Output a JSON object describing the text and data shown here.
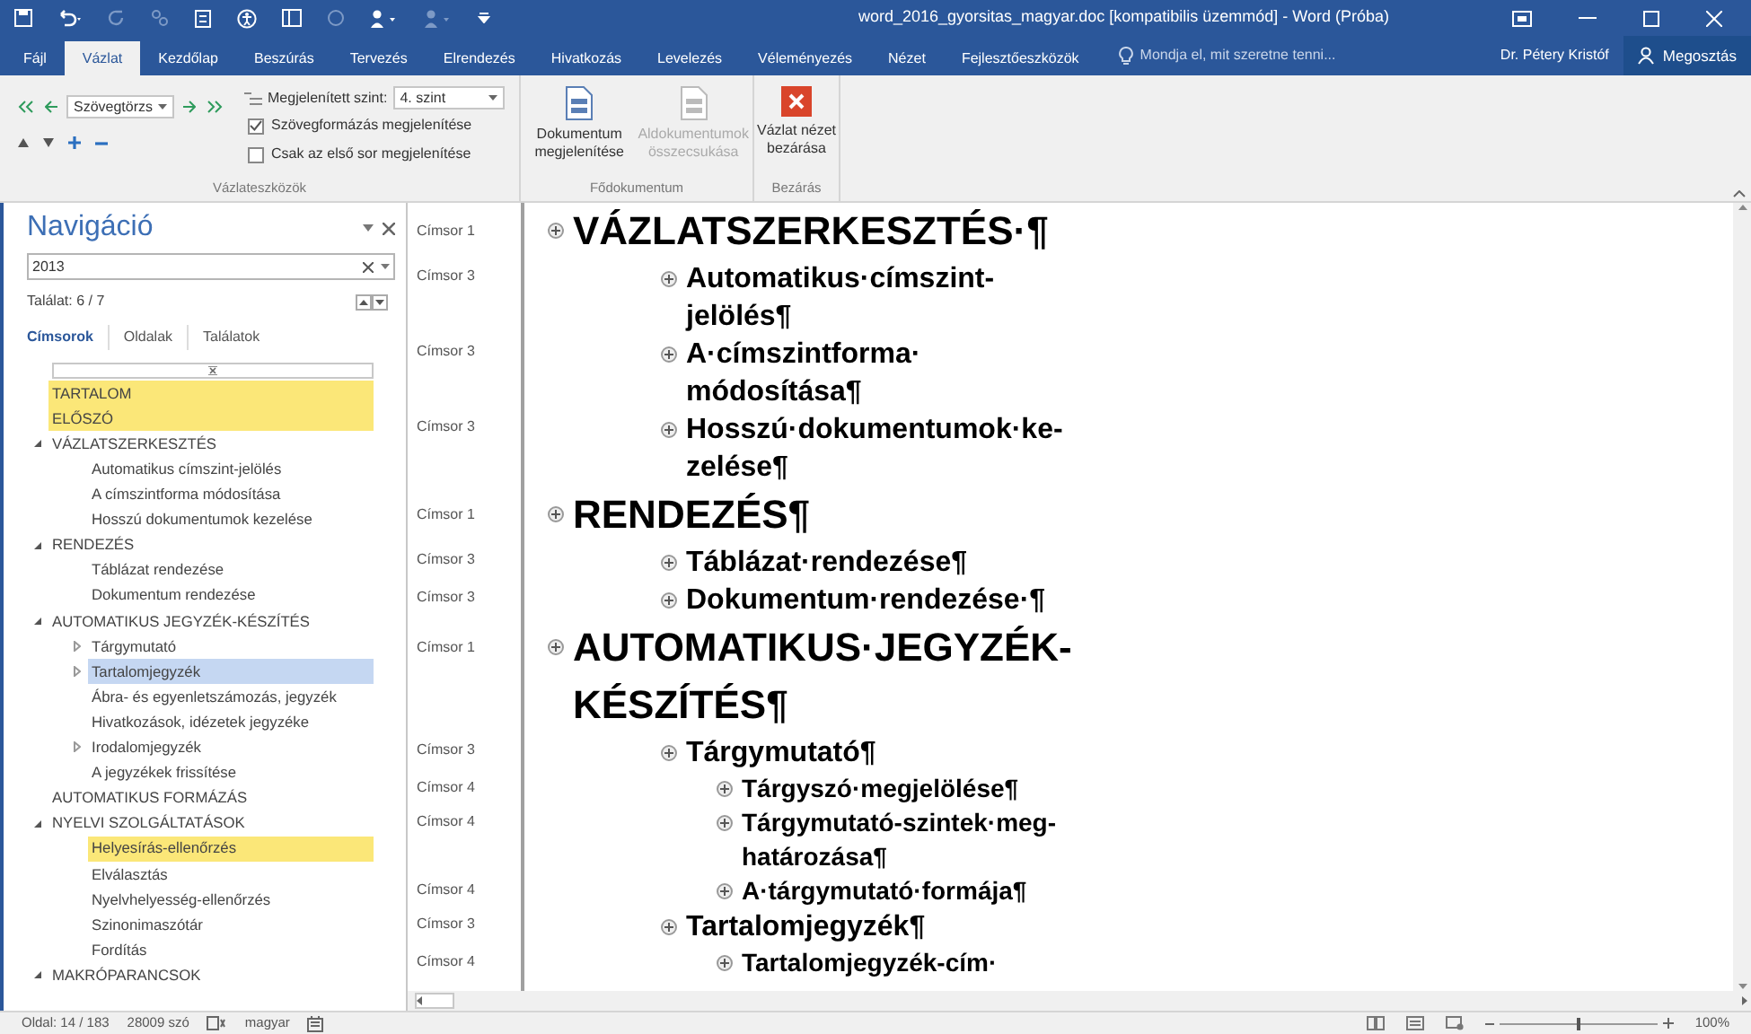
{
  "window": {
    "title": "word_2016_gyorsitas_magyar.doc [kompatibilis üzemmód] - Word (Próba)"
  },
  "ribbon_tabs": [
    {
      "label": "Fájl",
      "selected": false
    },
    {
      "label": "Vázlat",
      "selected": true
    },
    {
      "label": "Kezdőlap",
      "selected": false
    },
    {
      "label": "Beszúrás",
      "selected": false
    },
    {
      "label": "Tervezés",
      "selected": false
    },
    {
      "label": "Elrendezés",
      "selected": false
    },
    {
      "label": "Hivatkozás",
      "selected": false
    },
    {
      "label": "Levelezés",
      "selected": false
    },
    {
      "label": "Véleményezés",
      "selected": false
    },
    {
      "label": "Nézet",
      "selected": false
    },
    {
      "label": "Fejlesztőeszközök",
      "selected": false
    }
  ],
  "tell_me": {
    "placeholder": "Mondja el, mit szeretne tenni..."
  },
  "user": "Dr. Pétery Kristóf",
  "share_button": "Megosztás",
  "outline_tools": {
    "style_dropdown": "Szövegtörzs",
    "level_label": "Megjelenített szint:",
    "level_dropdown": "4. szint",
    "options": [
      {
        "label": "Szövegformázás megjelenítése",
        "checked": true
      },
      {
        "label": "Csak az első sor megjelenítése",
        "checked": false
      }
    ],
    "group_label": "Vázlateszközök"
  },
  "master_document": {
    "buttons": [
      {
        "label": "Dokumentum megjelenítése",
        "disabled": false
      },
      {
        "label": "Aldokumentumok összecsukása",
        "disabled": true
      }
    ],
    "group_label": "Fődokumentum"
  },
  "close_group": {
    "button": "Vázlat nézet bezárása",
    "group_label": "Bezárás"
  },
  "navigation": {
    "title": "Navigáció",
    "search": {
      "value": "2013"
    },
    "result": "Találat: 6 / 7",
    "tabs": [
      {
        "label": "Címsorok",
        "selected": true
      },
      {
        "label": "Oldalak",
        "selected": false
      },
      {
        "label": "Találatok",
        "selected": false
      }
    ],
    "tree": [
      {
        "label": "TARTALOM",
        "highlighted": true,
        "selected": false
      },
      {
        "label": "ELŐSZÓ",
        "highlighted": true,
        "selected": false
      },
      {
        "label": "VÁZLATSZERKESZTÉS",
        "highlighted": false,
        "selected": false,
        "expanded": true,
        "children": [
          {
            "label": "Automatikus címszint-jelölés",
            "highlighted": false,
            "selected": false
          },
          {
            "label": "A címszintforma módosítása",
            "highlighted": false,
            "selected": false
          },
          {
            "label": "Hosszú dokumentumok kezelése",
            "highlighted": false,
            "selected": false
          }
        ]
      },
      {
        "label": "RENDEZÉS",
        "highlighted": false,
        "selected": false,
        "expanded": true,
        "children": [
          {
            "label": "Táblázat rendezése",
            "highlighted": false,
            "selected": false
          },
          {
            "label": "Dokumentum rendezése",
            "highlighted": false,
            "selected": false
          }
        ]
      },
      {
        "label": "AUTOMATIKUS JEGYZÉK-KÉSZÍTÉS",
        "highlighted": false,
        "selected": false,
        "expanded": true,
        "children": [
          {
            "label": "Tárgymutató",
            "highlighted": false,
            "selected": false,
            "expanded": false
          },
          {
            "label": "Tartalomjegyzék",
            "highlighted": false,
            "selected": true,
            "expanded": false
          },
          {
            "label": "Ábra- és egyenletszámozás, jegyzék",
            "highlighted": false,
            "selected": false
          },
          {
            "label": "Hivatkozások, idézetek jegyzéke",
            "highlighted": false,
            "selected": false
          },
          {
            "label": "Irodalomjegyzék",
            "highlighted": false,
            "selected": false,
            "expanded": false
          },
          {
            "label": "A jegyzékek frissítése",
            "highlighted": false,
            "selected": false
          }
        ]
      },
      {
        "label": "AUTOMATIKUS FORMÁZÁS",
        "highlighted": false,
        "selected": false
      },
      {
        "label": "NYELVI SZOLGÁLTATÁSOK",
        "highlighted": false,
        "selected": false,
        "expanded": true,
        "children": [
          {
            "label": "Helyesírás-ellenőrzés",
            "highlighted": true,
            "selected": false
          },
          {
            "label": "Elválasztás",
            "highlighted": false,
            "selected": false
          },
          {
            "label": "Nyelvhelyesség-ellenőrzés",
            "highlighted": false,
            "selected": false
          },
          {
            "label": "Szinonimaszótár",
            "highlighted": false,
            "selected": false
          },
          {
            "label": "Fordítás",
            "highlighted": false,
            "selected": false
          }
        ]
      },
      {
        "label": "MAKRÓPARANCSOK",
        "highlighted": false,
        "selected": false,
        "expanded": true
      }
    ]
  },
  "outline": [
    {
      "style": "Címsor 1",
      "lines": [
        "VÁZLATSZERKESZTÉS·¶"
      ],
      "children": [
        {
          "style": "Címsor 3",
          "lines": [
            "Automatikus·címszint-",
            "jelölés¶"
          ]
        },
        {
          "style": "Címsor 3",
          "lines": [
            "A·címszintforma·",
            "módosítása¶"
          ]
        },
        {
          "style": "Címsor 3",
          "lines": [
            "Hosszú·dokumentumok·ke-",
            "zelése¶"
          ]
        }
      ]
    },
    {
      "style": "Címsor 1",
      "lines": [
        "RENDEZÉS¶"
      ],
      "children": [
        {
          "style": "Címsor 3",
          "lines": [
            "Táblázat·rendezése¶"
          ]
        },
        {
          "style": "Címsor 3",
          "lines": [
            "Dokumentum·rendezése·¶"
          ]
        }
      ]
    },
    {
      "style": "Címsor 1",
      "lines": [
        "AUTOMATIKUS·JEGYZÉK-",
        "KÉSZÍTÉS¶"
      ],
      "children": [
        {
          "style": "Címsor 3",
          "lines": [
            "Tárgymutató¶"
          ],
          "children": [
            {
              "style": "Címsor 4",
              "lines": [
                "Tárgyszó·megjelölése¶"
              ]
            },
            {
              "style": "Címsor 4",
              "lines": [
                "Tárgymutató-szintek·meg-",
                "határozása¶"
              ]
            },
            {
              "style": "Címsor 4",
              "lines": [
                "A·tárgymutató·formája¶"
              ]
            }
          ]
        },
        {
          "style": "Címsor 3",
          "lines": [
            "Tartalomjegyzék¶"
          ],
          "children": [
            {
              "style": "Címsor 4",
              "lines": [
                "Tartalomjegyzék-cím·"
              ]
            }
          ]
        }
      ]
    }
  ],
  "status_bar": {
    "page": "Oldal: 14 / 183",
    "words": "28009 szó",
    "language": "magyar",
    "zoom": "100%",
    "zoom_slider": {
      "level": 0.5
    }
  }
}
